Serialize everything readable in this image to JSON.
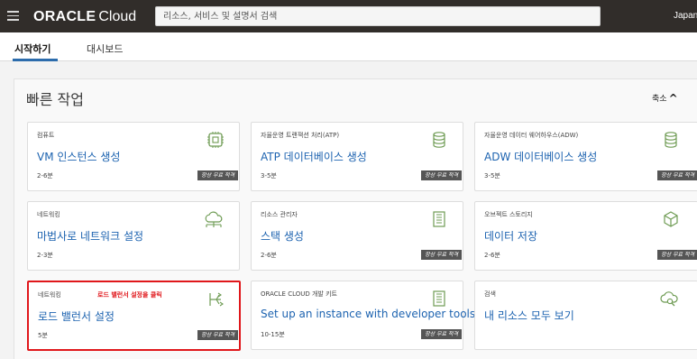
{
  "topbar": {
    "brand_oracle": "ORACLE",
    "brand_cloud": "Cloud",
    "search_placeholder": "리소스, 서비스 및 설명서 검색",
    "region": "Japan"
  },
  "tabs": [
    {
      "label": "시작하기",
      "active": true
    },
    {
      "label": "대시보드",
      "active": false
    }
  ],
  "quick_actions": {
    "title": "빠른 작업",
    "collapse_label": "축소"
  },
  "cards": [
    {
      "category": "컴퓨트",
      "title": "VM 인스턴스 생성",
      "duration": "2-6분",
      "badge": "항상 무료 적격",
      "icon": "chip-icon"
    },
    {
      "category": "자율운영 트랜잭션 처리(ATP)",
      "title": "ATP 데이터베이스 생성",
      "duration": "3-5분",
      "badge": "항상 무료 적격",
      "icon": "database-icon"
    },
    {
      "category": "자율운영 데이터 웨어하우스(ADW)",
      "title": "ADW 데이터베이스 생성",
      "duration": "3-5분",
      "badge": "항상 무료 적격",
      "icon": "database-icon"
    },
    {
      "category": "네트워킹",
      "title": "마법사로 네트워크 설정",
      "duration": "2-3분",
      "badge": "",
      "icon": "network-icon"
    },
    {
      "category": "리소스 관리자",
      "title": "스택 생성",
      "duration": "2-6분",
      "badge": "항상 무료 적격",
      "icon": "stack-icon"
    },
    {
      "category": "오브젝트 스토리지",
      "title": "데이터 저장",
      "duration": "2-6분",
      "badge": "항상 무료 적격",
      "icon": "cube-icon"
    },
    {
      "category": "네트워킹",
      "title": "로드 밸런서 설정",
      "duration": "5분",
      "badge": "항상 무료 적격",
      "icon": "load-balancer-icon",
      "annotation": "로드 밸런서 설정을 클릭"
    },
    {
      "category": "ORACLE CLOUD 개발 키트",
      "title": "Set up an instance with developer tools",
      "duration": "10-15분",
      "badge": "항상 무료 적격",
      "icon": "toolkit-icon"
    },
    {
      "category": "검색",
      "title": "내 리소스 모두 보기",
      "duration": "",
      "badge": "",
      "icon": "cloud-search-icon"
    }
  ],
  "colors": {
    "topbar": "#312d2a",
    "link": "#1d63b0",
    "highlight": "#e0171b",
    "icon_green": "#6e9b53"
  }
}
